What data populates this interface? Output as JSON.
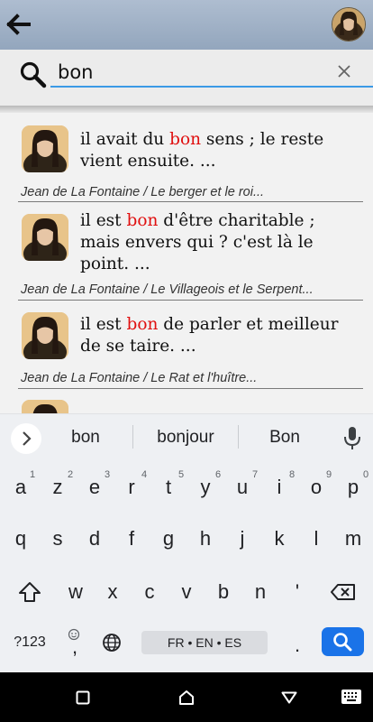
{
  "search": {
    "query": "bon",
    "placeholder": ""
  },
  "results": [
    {
      "pre": "il avait du ",
      "hl": "bon",
      "post": " sens ; le reste vient ensuite. ...",
      "source": "Jean de La Fontaine / Le berger et le roi..."
    },
    {
      "pre": "il est ",
      "hl": "bon",
      "post": " d'être charitable ; mais envers qui ? c'est là le point. ...",
      "source": "Jean de La Fontaine / Le Villageois et le Serpent..."
    },
    {
      "pre": "il est ",
      "hl": "bon",
      "post": " de parler et meilleur de se taire. ...",
      "source": "Jean de La Fontaine / Le Rat et l'huître..."
    }
  ],
  "keyboard": {
    "suggestions": [
      "bon",
      "bonjour",
      "Bon"
    ],
    "row1": [
      "a",
      "z",
      "e",
      "r",
      "t",
      "y",
      "u",
      "i",
      "o",
      "p"
    ],
    "row1_hints": [
      "1",
      "2",
      "3",
      "4",
      "5",
      "6",
      "7",
      "8",
      "9",
      "0"
    ],
    "row2": [
      "q",
      "s",
      "d",
      "f",
      "g",
      "h",
      "j",
      "k",
      "l",
      "m"
    ],
    "row3": [
      "w",
      "x",
      "c",
      "v",
      "b",
      "n",
      "'"
    ],
    "symbols_label": "?123",
    "comma": ",",
    "period": ".",
    "space_label": "FR • EN • ES"
  }
}
